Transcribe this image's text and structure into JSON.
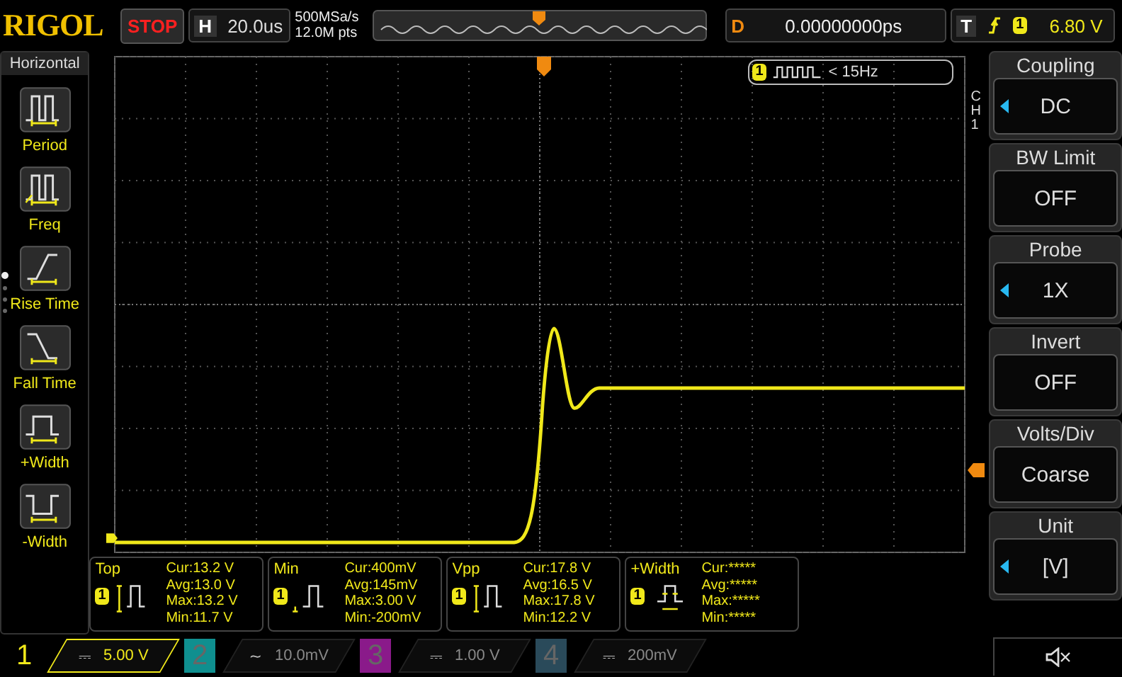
{
  "top_bar": {
    "logo": "RIGOL",
    "run_state": "STOP",
    "horizontal": {
      "label": "H",
      "value": "20.0us"
    },
    "sample_rate": "500MSa/s",
    "memory_depth": "12.0M pts",
    "delay": {
      "label": "D",
      "value": "0.00000000ps"
    },
    "trigger": {
      "label": "T",
      "channel": "1",
      "level": "6.80 V"
    }
  },
  "left_menu": {
    "title": "Horizontal",
    "items": [
      {
        "label": "Period",
        "kind": "period"
      },
      {
        "label": "Freq",
        "kind": "freq"
      },
      {
        "label": "Rise Time",
        "kind": "rise"
      },
      {
        "label": "Fall Time",
        "kind": "fall"
      },
      {
        "label": "+Width",
        "kind": "pwidth"
      },
      {
        "label": "-Width",
        "kind": "nwidth"
      }
    ],
    "pages": [
      {
        "selected": true
      },
      {
        "selected": false
      },
      {
        "selected": false
      },
      {
        "selected": false
      }
    ]
  },
  "plot": {
    "channel_tag": "CH1",
    "frequency_badge": {
      "channel": "1",
      "text": "< 15Hz"
    }
  },
  "measurements": [
    {
      "name": "Top",
      "channel": "1",
      "kind": "top",
      "rows": [
        {
          "label": "Cur:",
          "value": "13.2 V"
        },
        {
          "label": "Avg:",
          "value": "13.0 V"
        },
        {
          "label": "Max:",
          "value": "13.2 V"
        },
        {
          "label": "Min:",
          "value": "11.7 V"
        }
      ]
    },
    {
      "name": "Min",
      "channel": "1",
      "kind": "min",
      "rows": [
        {
          "label": "Cur:",
          "value": "400mV"
        },
        {
          "label": "Avg:",
          "value": "145mV"
        },
        {
          "label": "Max:",
          "value": "3.00 V"
        },
        {
          "label": "Min:",
          "value": "-200mV"
        }
      ]
    },
    {
      "name": "Vpp",
      "channel": "1",
      "kind": "vpp",
      "rows": [
        {
          "label": "Cur:",
          "value": "17.8 V"
        },
        {
          "label": "Avg:",
          "value": "16.5 V"
        },
        {
          "label": "Max:",
          "value": "17.8 V"
        },
        {
          "label": "Min:",
          "value": "12.2 V"
        }
      ]
    },
    {
      "name": "+Width",
      "channel": "1",
      "kind": "pwidth",
      "rows": [
        {
          "label": "Cur:",
          "value": "*****"
        },
        {
          "label": "Avg:",
          "value": "*****"
        },
        {
          "label": "Max:",
          "value": "*****"
        },
        {
          "label": "Min:",
          "value": "*****"
        }
      ]
    }
  ],
  "right_menu": [
    {
      "title": "Coupling",
      "value": "DC",
      "arrow": true
    },
    {
      "title": "BW Limit",
      "value": "OFF",
      "arrow": false
    },
    {
      "title": "Probe",
      "value": "1X",
      "arrow": true
    },
    {
      "title": "Invert",
      "value": "OFF",
      "arrow": false
    },
    {
      "title": "Volts/Div",
      "value": "Coarse",
      "arrow": false
    },
    {
      "title": "Unit",
      "value": "[V]",
      "arrow": true
    }
  ],
  "channels": [
    {
      "number": "1",
      "coupling": "⎓",
      "scale": "5.00 V",
      "enabled": true,
      "color": "#f0e81a"
    },
    {
      "number": "2",
      "coupling": "~",
      "scale": "10.0mV",
      "enabled": false,
      "color": "#0f8f8f"
    },
    {
      "number": "3",
      "coupling": "⎓",
      "scale": "1.00 V",
      "enabled": false,
      "color": "#8a1a8a"
    },
    {
      "number": "4",
      "coupling": "⎓",
      "scale": "200mV",
      "enabled": false,
      "color": "#2a4a5a"
    }
  ],
  "sound": {
    "muted": true
  }
}
